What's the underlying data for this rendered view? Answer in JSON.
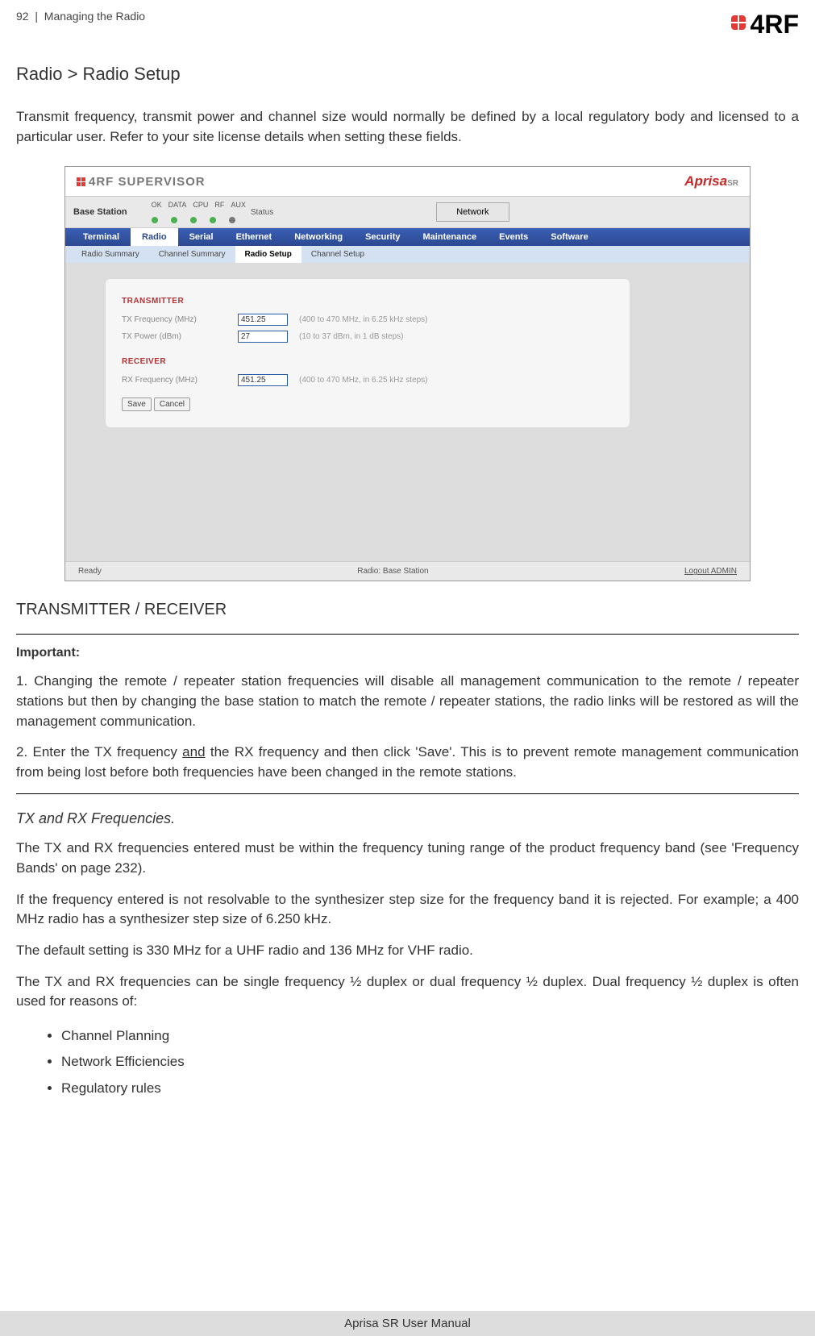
{
  "header": {
    "page_number": "92",
    "separator": "|",
    "chapter": "Managing the Radio",
    "logo_text": "4RF"
  },
  "title": "Radio > Radio Setup",
  "intro_para": "Transmit frequency, transmit power and channel size would normally be defined by a local regulatory body and licensed to a particular user. Refer to your site license details when setting these fields.",
  "screenshot": {
    "supervisor_label": "SUPERVISOR",
    "aprisa_label": "Aprisa",
    "aprisa_sr": "SR",
    "base_station": "Base Station",
    "status_label": "Status",
    "leds": [
      "OK",
      "DATA",
      "CPU",
      "RF",
      "AUX"
    ],
    "network_btn": "Network",
    "nav": [
      "Terminal",
      "Radio",
      "Serial",
      "Ethernet",
      "Networking",
      "Security",
      "Maintenance",
      "Events",
      "Software"
    ],
    "subnav": [
      "Radio Summary",
      "Channel Summary",
      "Radio Setup",
      "Channel Setup"
    ],
    "transmitter_heading": "TRANSMITTER",
    "tx_freq_label": "TX Frequency (MHz)",
    "tx_freq_value": "451.25",
    "tx_freq_hint": "(400 to 470 MHz, in 6.25 kHz steps)",
    "tx_power_label": "TX Power (dBm)",
    "tx_power_value": "27",
    "tx_power_hint": "(10 to 37 dBm, in 1 dB steps)",
    "receiver_heading": "RECEIVER",
    "rx_freq_label": "RX Frequency (MHz)",
    "rx_freq_value": "451.25",
    "rx_freq_hint": "(400 to 470 MHz, in 6.25 kHz steps)",
    "save_btn": "Save",
    "cancel_btn": "Cancel",
    "footer_ready": "Ready",
    "footer_radio": "Radio: Base Station",
    "footer_logout": "Logout ADMIN"
  },
  "sub_title": "TRANSMITTER / RECEIVER",
  "important_label": "Important:",
  "important_1": "1. Changing the remote / repeater station frequencies will disable all management communication to the remote / repeater stations but then by changing the base station to match the remote / repeater stations, the radio links will be restored as will the management communication.",
  "important_2_pre": "2. Enter the TX frequency ",
  "important_2_and": "and",
  "important_2_post": " the RX frequency and then click 'Save'. This is to prevent remote management communication from being lost before both frequencies have been changed in the remote stations.",
  "tx_rx_heading": "TX and RX Frequencies.",
  "body_1": "The TX and RX frequencies entered must be within the frequency tuning range of the product frequency band (see 'Frequency Bands' on page 232).",
  "body_2": "If the frequency entered is not resolvable to the synthesizer step size for the frequency band it is rejected. For example; a 400 MHz radio has a synthesizer step size of 6.250 kHz.",
  "body_3": "The default setting is 330 MHz for a UHF radio and 136 MHz for VHF radio.",
  "body_4": "The TX and RX frequencies can be single frequency ½ duplex or dual frequency ½ duplex. Dual frequency ½ duplex is often used for reasons of:",
  "bullets": [
    "Channel Planning",
    "Network Efficiencies",
    "Regulatory rules"
  ],
  "footer": "Aprisa SR User Manual"
}
